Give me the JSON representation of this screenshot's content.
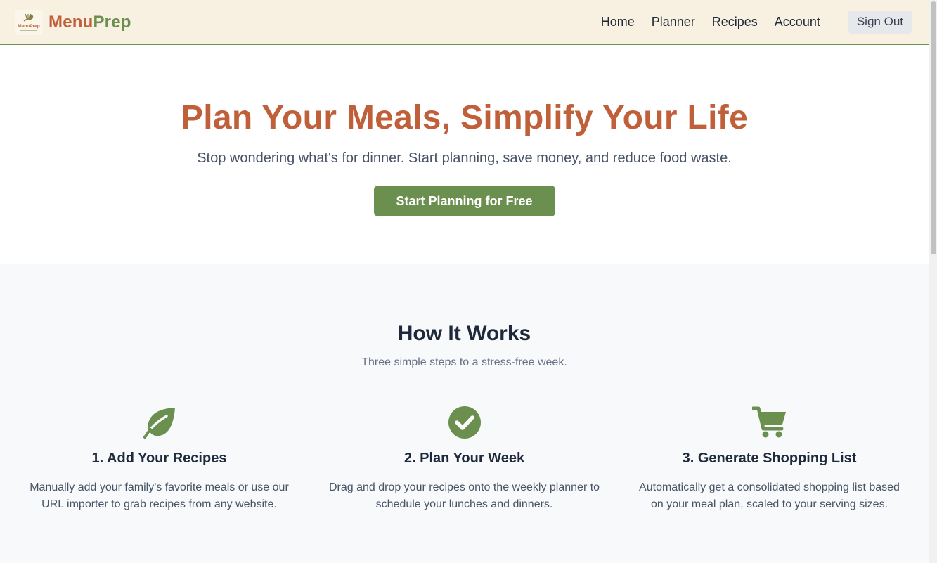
{
  "brand": {
    "logo_text": "MenuPrep",
    "name_part1": "Menu",
    "name_part2": "Prep"
  },
  "nav": {
    "items": [
      "Home",
      "Planner",
      "Recipes",
      "Account"
    ],
    "sign_out": "Sign Out"
  },
  "hero": {
    "title": "Plan Your Meals, Simplify Your Life",
    "subtitle": "Stop wondering what's for dinner. Start planning, save money, and reduce food waste.",
    "cta": "Start Planning for Free"
  },
  "how": {
    "title": "How It Works",
    "subtitle": "Three simple steps to a stress-free week.",
    "steps": [
      {
        "icon": "leaf-icon",
        "title": "1. Add Your Recipes",
        "text": "Manually add your family's favorite meals or use our URL importer to grab recipes from any website."
      },
      {
        "icon": "check-circle-icon",
        "title": "2. Plan Your Week",
        "text": "Drag and drop your recipes onto the weekly planner to schedule your lunches and dinners."
      },
      {
        "icon": "shopping-cart-icon",
        "title": "3. Generate Shopping List",
        "text": "Automatically get a consolidated shopping list based on your meal plan, scaled to your serving sizes."
      }
    ]
  },
  "colors": {
    "brand_orange": "#c0603a",
    "brand_green": "#6a8f4f",
    "header_bg": "#f8f0e1"
  }
}
